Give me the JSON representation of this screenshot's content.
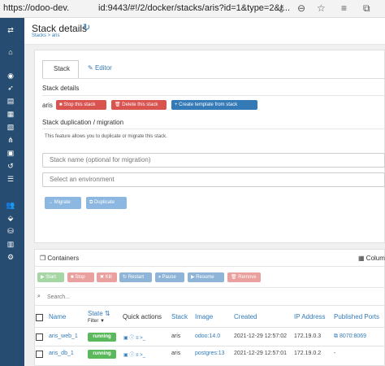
{
  "browser": {
    "url_left": "https://odoo-dev.",
    "url_right": "id:9443/#!/2/docker/stacks/aris?id=1&type=2&r..."
  },
  "header": {
    "title": "Stack details",
    "breadcrumb": "Stacks > aris"
  },
  "tabs": {
    "stack": "Stack",
    "editor": "Editor"
  },
  "stack_details": {
    "heading": "Stack details",
    "name": "aris",
    "stop": "Stop this stack",
    "delete": "Delete this stack",
    "create_template": "Create template from stack"
  },
  "duplication": {
    "heading": "Stack duplication / migration",
    "description": "This feature allows you to duplicate or migrate this stack.",
    "stack_name_placeholder": "Stack name (optional for migration)",
    "environment_placeholder": "Select an environment",
    "migrate": "Migrate",
    "duplicate": "Duplicate"
  },
  "containers": {
    "heading": "Containers",
    "columns_label": "Colum",
    "start": "Start",
    "stop": "Stop",
    "kill": "Kill",
    "restart": "Restart",
    "pause": "Pause",
    "resume": "Resume",
    "remove": "Remove",
    "search_placeholder": "Search...",
    "headers": {
      "name": "Name",
      "state": "State",
      "filter": "Filter",
      "quick_actions": "Quick actions",
      "stack": "Stack",
      "image": "Image",
      "created": "Created",
      "ip": "IP Address",
      "ports": "Published Ports"
    },
    "rows": [
      {
        "name": "aris_web_1",
        "state": "running",
        "stack": "aris",
        "image": "odoo:14.0",
        "created": "2021-12-29 12:57:02",
        "ip": "172.19.0.3",
        "ports": "8070:8069"
      },
      {
        "name": "aris_db_1",
        "state": "running",
        "stack": "aris",
        "image": "postgres:13",
        "created": "2021-12-29 12:57:01",
        "ip": "172.19.0.2",
        "ports": "-"
      }
    ]
  }
}
